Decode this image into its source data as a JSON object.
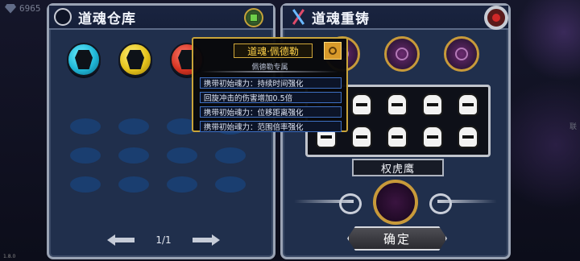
{
  "hud": {
    "gem_count": "6965"
  },
  "left_panel": {
    "title": "道魂仓库",
    "soul_orbs": [
      {
        "color": "cyan"
      },
      {
        "color": "yellow"
      },
      {
        "color": "red"
      }
    ],
    "empty_slot_rows": 3,
    "pager": {
      "page_text": "1/1"
    }
  },
  "tooltip": {
    "title": "道魂·佩德勒",
    "subtitle": "佩德勒专属",
    "effects": [
      "携带初始魂力：持续时间强化",
      "回旋冲击的伤害增加0.5倍",
      "携带初始魂力：位移距离强化",
      "携带初始魂力：范围倍率强化"
    ]
  },
  "right_panel": {
    "title": "道魂重铸",
    "selected_name": "权虎鹰",
    "confirm_label": "确定"
  },
  "footer": {
    "version": "1.8.0"
  },
  "edge_text": "联"
}
